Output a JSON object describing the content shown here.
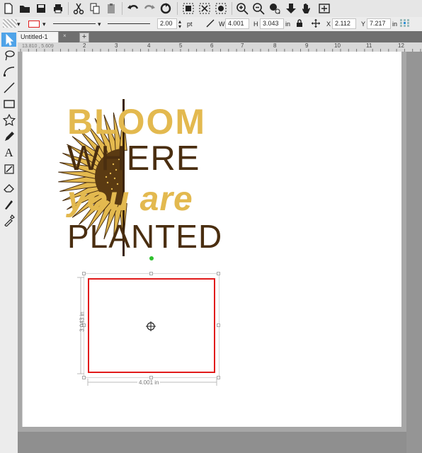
{
  "document": {
    "tab_title": "Untitled-1",
    "tab_close": "×",
    "tab_add": "+"
  },
  "toolbar": {
    "icons": [
      "new-file-icon",
      "open-folder-icon",
      "save-icon",
      "print-icon",
      "cut-icon",
      "copy-icon",
      "paste-icon",
      "clipboard-icon",
      "undo-icon",
      "redo-icon",
      "refresh-icon",
      "select-all-icon",
      "deselect-icon",
      "zoom-select-icon",
      "zoom-in-icon",
      "zoom-out-icon",
      "zoom-fit-icon",
      "move-down-icon",
      "pan-hand-icon",
      "fit-page-icon"
    ]
  },
  "properties": {
    "stroke_width": "2.00",
    "stroke_unit": "pt",
    "w_label": "W",
    "w_value": "4.001",
    "h_label": "H",
    "h_value": "3.043",
    "wh_unit": "in",
    "x_label": "X",
    "x_value": "2.112",
    "y_label": "Y",
    "y_value": "7.217",
    "xy_unit": "in"
  },
  "ruler": {
    "coord": "13.810 , 5.609",
    "ticks": [
      "2",
      "3",
      "4",
      "5",
      "6",
      "7",
      "8",
      "9",
      "10",
      "11",
      "12"
    ]
  },
  "artwork": {
    "line1": "BLOOM",
    "line2": "WHERE",
    "line3": "you are",
    "line4": "PLANTED",
    "gold": "#e3b94f",
    "brown": "#4a2e10"
  },
  "selection": {
    "height_label": "3.043 in",
    "width_label": "4.001 in",
    "stroke_color": "#e11b1b"
  },
  "tools": [
    "select-arrow-icon",
    "lasso-icon",
    "pen-curve-icon",
    "line-icon",
    "rectangle-icon",
    "star-icon",
    "pencil-icon",
    "text-icon",
    "image-edit-icon",
    "eraser-icon",
    "knife-icon",
    "eyedropper-icon"
  ]
}
